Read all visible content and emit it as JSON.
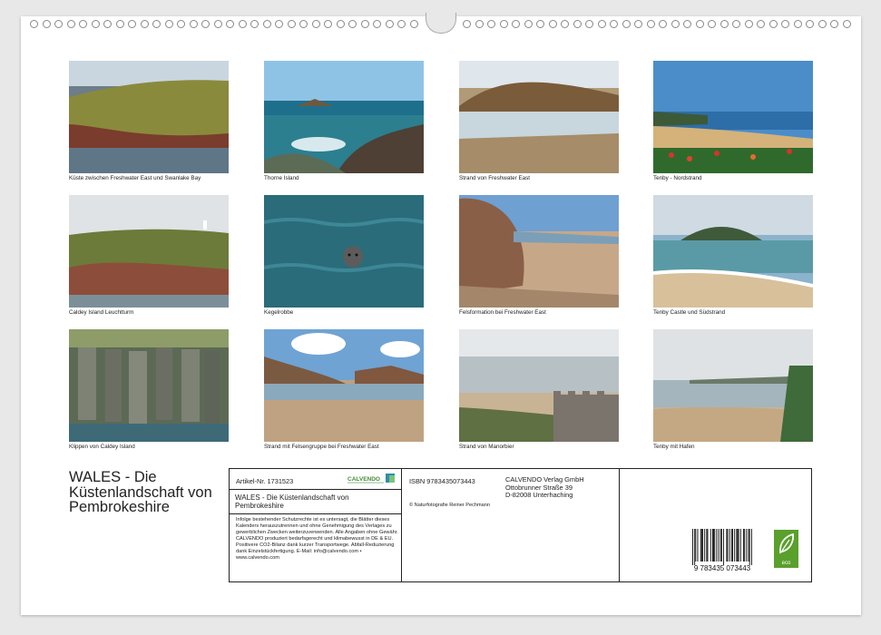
{
  "rings": {
    "count_left": 32,
    "count_right": 32
  },
  "photos": [
    {
      "caption": "Küste zwischen Freshwater East und Swanlake Bay",
      "scene": "cliff-grass"
    },
    {
      "caption": "Thorne Island",
      "scene": "sea-rocks"
    },
    {
      "caption": "Strand von Freshwater East",
      "scene": "beach-reflection"
    },
    {
      "caption": "Tenby - Nordstrand",
      "scene": "beach-flowers"
    },
    {
      "caption": "Caldey Island Leuchtturm",
      "scene": "green-headland"
    },
    {
      "caption": "Kegelrobbe",
      "scene": "seal-water"
    },
    {
      "caption": "Felsformation bei Freshwater East",
      "scene": "red-rock-beach"
    },
    {
      "caption": "Tenby Castle und Südstrand",
      "scene": "island-beach"
    },
    {
      "caption": "Klippen von Caldey Island",
      "scene": "rock-columns"
    },
    {
      "caption": "Strand mit Felsengruppe bei Freshwater East",
      "scene": "rocky-beach-sky"
    },
    {
      "caption": "Strand von Manorbier",
      "scene": "manorbier"
    },
    {
      "caption": "Tenby mit Hafen",
      "scene": "harbour-sand"
    }
  ],
  "title": "WALES - Die Küstenlandschaft von Pembrokeshire",
  "info": {
    "article": "Artikel-Nr. 1731523",
    "logo_text": "CALVENDO",
    "calendar_title": "WALES - Die Küstenlandschaft von Pembrokeshire",
    "legal": "Infolge bestehender Schutzrechte ist es untersagt, die Blätter dieses Kalenders herauszutrennen und ohne Genehmigung des Verlages zu gewerblichen Zwecken weiterzuverwenden. Alle Angaben ohne Gewähr. CALVENDO produziert bedarfsgerecht und klimabewusst in DE & EU. Positivere CO2-Bilanz dank kurzer Transportwege. Abfall-Reduzierung dank Einzelstückfertigung. E-Mail: info@calvendo.com • www.calvendo.com",
    "isbn": "ISBN 9783435073443",
    "publisher_line1": "CALVENDO Verlag GmbH",
    "publisher_line2": "Ottobrunner Straße 39",
    "publisher_line3": "D-82008 Unterhaching",
    "photographer": "© Naturfotografie Reiner Pechmann",
    "barcode_number": "9   783435   073443",
    "eco_label": "eco"
  }
}
